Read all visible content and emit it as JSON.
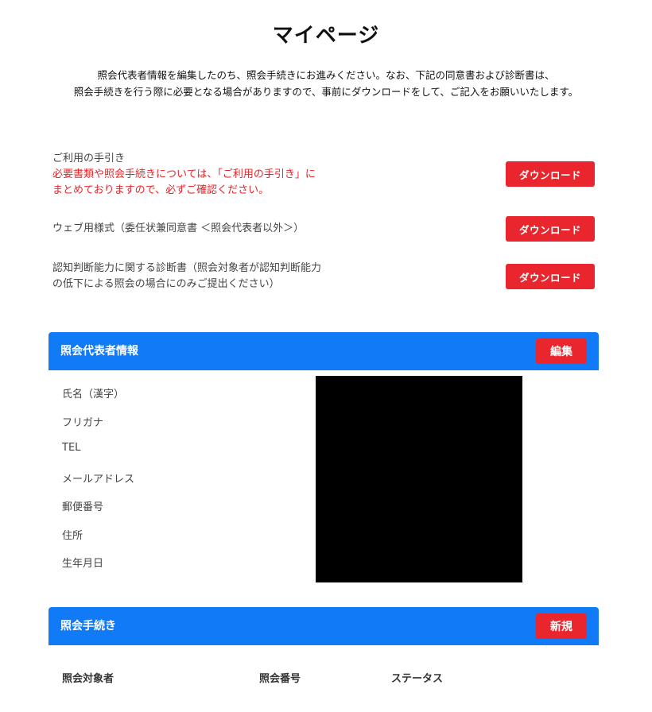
{
  "page": {
    "title": "マイページ",
    "intro_line1": "照会代表者情報を編集したのち、照会手続きにお進みください。なお、下記の同意書および診断書は、",
    "intro_line2": "照会手続きを行う際に必要となる場合がありますので、事前にダウンロードをして、ご記入をお願いいたします。"
  },
  "downloads": [
    {
      "title": "ご利用の手引き",
      "note_line1": "必要書類や照会手続きについては、「ご利用の手引き」に",
      "note_line2": "まとめておりますので、必ずご確認ください。",
      "button": "ダウンロード"
    },
    {
      "title": "ウェブ用様式（委任状兼同意書 ＜照会代表者以外＞）",
      "button": "ダウンロード"
    },
    {
      "title_line1": "認知判断能力に関する診断書（照会対象者が認知判断能力",
      "title_line2": "の低下による照会の場合にのみご提出ください）",
      "button": "ダウンロード"
    }
  ],
  "representative": {
    "header": "照会代表者情報",
    "edit_button": "編集",
    "fields": [
      "氏名（漢字）",
      "フリガナ",
      "TEL",
      "メールアドレス",
      "郵便番号",
      "住所",
      "生年月日"
    ]
  },
  "procedures": {
    "header": "照会手続き",
    "new_button": "新規",
    "columns": [
      "照会対象者",
      "照会番号",
      "ステータス"
    ]
  },
  "colors": {
    "accent_blue": "#117af6",
    "button_red": "#e9262d",
    "note_red": "#e3262b"
  }
}
